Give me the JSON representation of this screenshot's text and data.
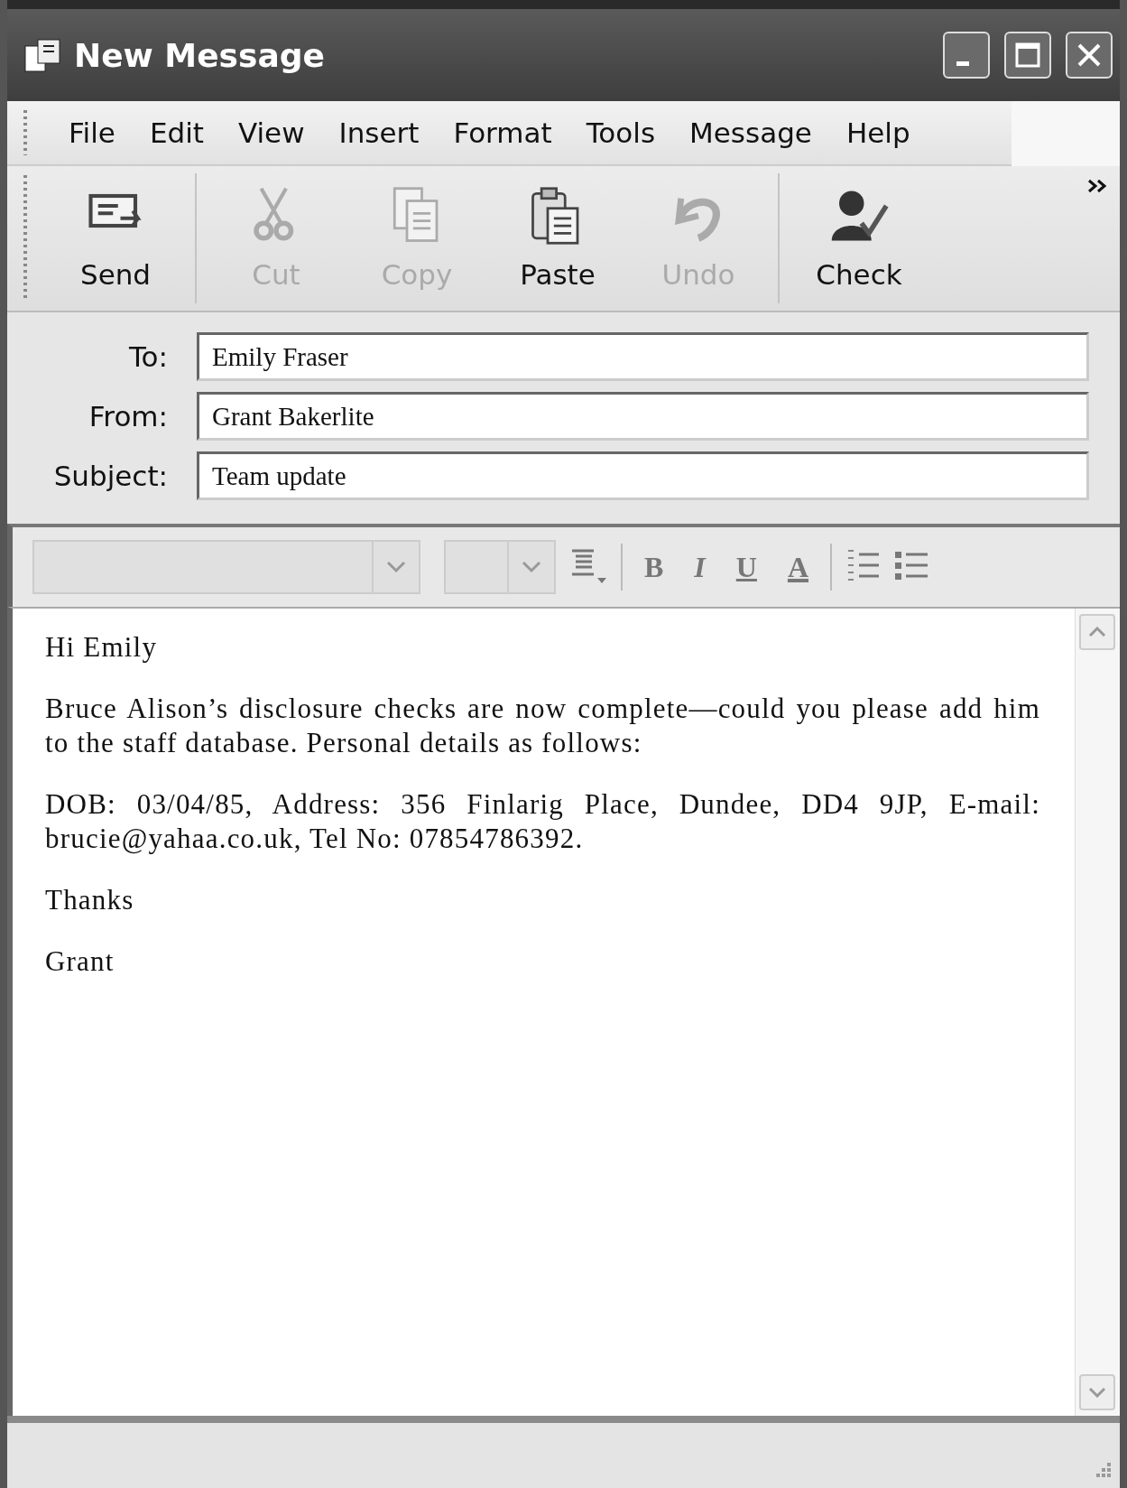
{
  "window": {
    "title": "New Message"
  },
  "menu": [
    "File",
    "Edit",
    "View",
    "Insert",
    "Format",
    "Tools",
    "Message",
    "Help"
  ],
  "toolbar": [
    {
      "label": "Send",
      "kind": "send",
      "disabled": false
    },
    {
      "label": "Cut",
      "kind": "cut",
      "disabled": true
    },
    {
      "label": "Copy",
      "kind": "copy",
      "disabled": true
    },
    {
      "label": "Paste",
      "kind": "paste",
      "disabled": false
    },
    {
      "label": "Undo",
      "kind": "undo",
      "disabled": true
    },
    {
      "label": "Check",
      "kind": "check",
      "disabled": false
    }
  ],
  "fields": [
    {
      "label": "To:",
      "value": "Emily Fraser"
    },
    {
      "label": "From:",
      "value": "Grant Bakerlite"
    },
    {
      "label": "Subject:",
      "value": "Team update"
    }
  ],
  "format_bar": {
    "buttons": [
      {
        "label": "B",
        "kind": "bold"
      },
      {
        "label": "I",
        "kind": "italic"
      },
      {
        "label": "U",
        "kind": "underline"
      },
      {
        "label": "A",
        "kind": "color"
      }
    ]
  },
  "body": {
    "paragraphs": [
      "Hi Emily",
      "Bruce Alison’s disclosure checks are now complete—could you please add him to the staff database.  Personal details as follows:",
      "DOB: 03/04/85, Address: 356 Finlarig Place, Dundee, DD4 9JP, E-mail: brucie@yahaa.co.uk, Tel No: 07854786392.",
      "Thanks",
      "Grant"
    ]
  }
}
